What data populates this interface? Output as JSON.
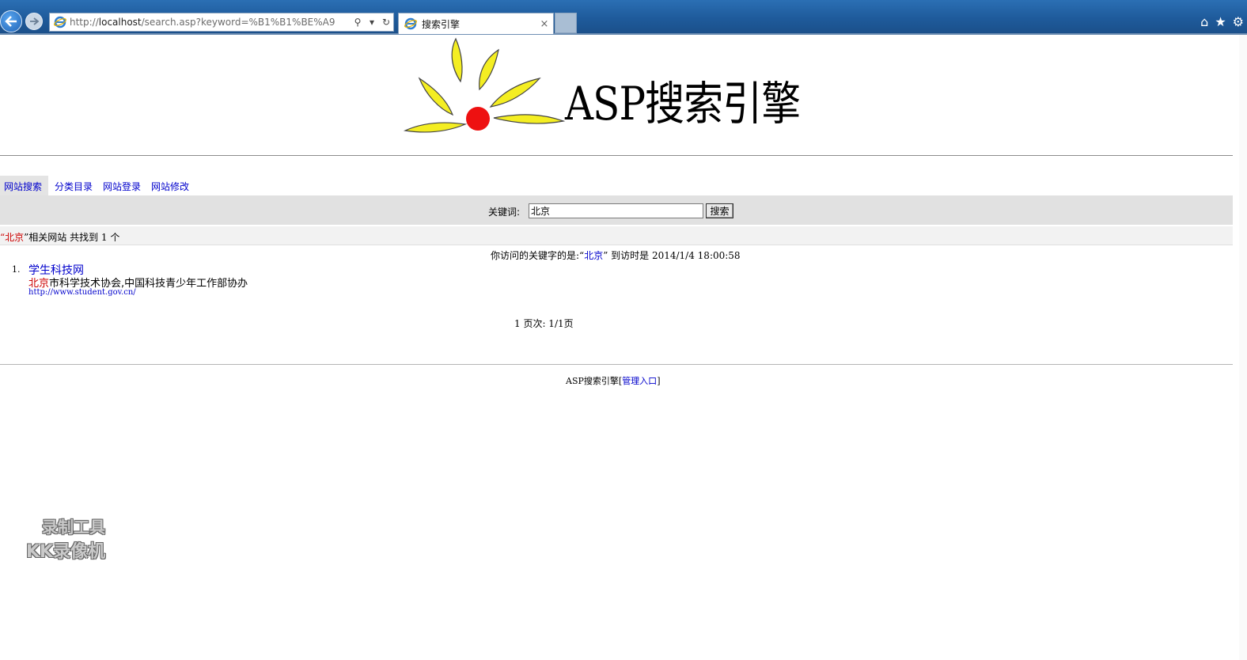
{
  "browser": {
    "address_url_prefix": "http://",
    "address_url_host": "localhost",
    "address_url_path": "/search.asp?keyword=%B1%B1%BE%A9",
    "tab_title": "搜索引擎",
    "tab_close": "×"
  },
  "header": {
    "site_title": "ASP搜索引擎"
  },
  "menu": {
    "items": [
      {
        "label": "网站搜索"
      },
      {
        "label": "分类目录"
      },
      {
        "label": "网站登录"
      },
      {
        "label": "网站修改"
      }
    ]
  },
  "search": {
    "label": "关键词:",
    "value": "北京",
    "button": "搜索"
  },
  "summary": {
    "open_quote": "“",
    "keyword": "北京",
    "rest": "”相关网站 共找到 1 个"
  },
  "visit": {
    "prefix": "你访问的关键字的是:“",
    "keyword": "北京",
    "suffix": "” 到访时是 2014/1/4 18:00:58"
  },
  "results": [
    {
      "num": "1.",
      "title": "学生科技网",
      "desc_highlight": "北京",
      "desc_rest": "市科学技术协会,中国科技青少年工作部协办",
      "url": "http://www.student.gov.cn/"
    }
  ],
  "pager": {
    "text": "1 页次: 1/1页"
  },
  "footer": {
    "text": "ASP搜索引擎[",
    "admin_link": "管理入口",
    "close": "]"
  },
  "watermark": {
    "line1": "录制工具",
    "line2": "KK录像机"
  },
  "colors": {
    "link": "#0000cc",
    "highlight": "#cc0000",
    "searchbar_bg": "#e1e1e1"
  }
}
